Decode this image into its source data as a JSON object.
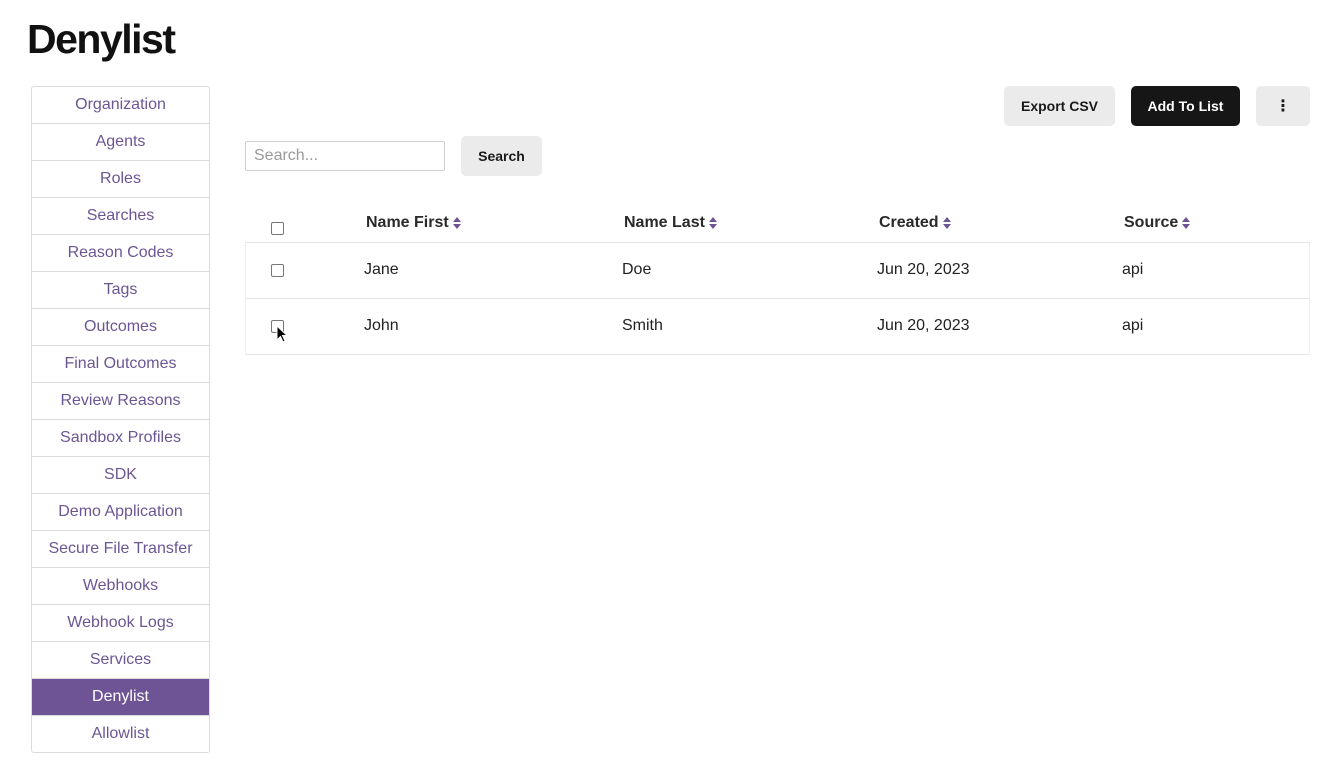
{
  "page": {
    "title": "Denylist"
  },
  "sidebar": {
    "items": [
      {
        "label": "Organization",
        "active": false
      },
      {
        "label": "Agents",
        "active": false
      },
      {
        "label": "Roles",
        "active": false
      },
      {
        "label": "Searches",
        "active": false
      },
      {
        "label": "Reason Codes",
        "active": false
      },
      {
        "label": "Tags",
        "active": false
      },
      {
        "label": "Outcomes",
        "active": false
      },
      {
        "label": "Final Outcomes",
        "active": false
      },
      {
        "label": "Review Reasons",
        "active": false
      },
      {
        "label": "Sandbox Profiles",
        "active": false
      },
      {
        "label": "SDK",
        "active": false
      },
      {
        "label": "Demo Application",
        "active": false
      },
      {
        "label": "Secure File Transfer",
        "active": false
      },
      {
        "label": "Webhooks",
        "active": false
      },
      {
        "label": "Webhook Logs",
        "active": false
      },
      {
        "label": "Services",
        "active": false
      },
      {
        "label": "Denylist",
        "active": true
      },
      {
        "label": "Allowlist",
        "active": false
      }
    ]
  },
  "toolbar": {
    "export_label": "Export CSV",
    "add_label": "Add To List",
    "more_label": "⋮"
  },
  "search": {
    "placeholder": "Search...",
    "value": "",
    "button_label": "Search"
  },
  "table": {
    "columns": [
      "Name First",
      "Name Last",
      "Created",
      "Source"
    ],
    "rows": [
      {
        "first": "Jane",
        "last": "Doe",
        "created": "Jun 20, 2023",
        "source": "api",
        "checked": false
      },
      {
        "first": "John",
        "last": "Smith",
        "created": "Jun 20, 2023",
        "source": "api",
        "checked": false
      }
    ]
  },
  "colors": {
    "accent": "#6e5494",
    "link": "#6b5694",
    "dark_button": "#161616",
    "light_button": "#ebebeb"
  }
}
